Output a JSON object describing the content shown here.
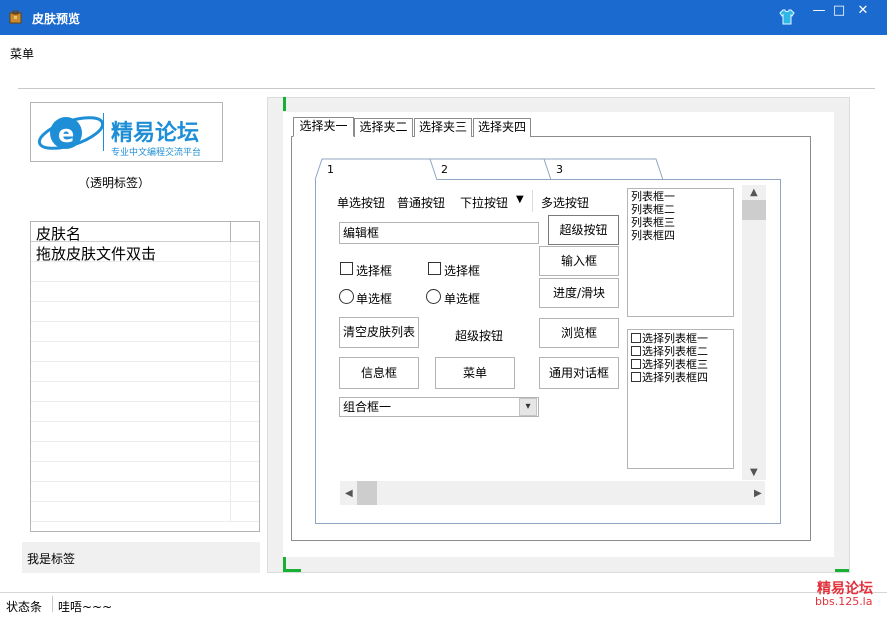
{
  "window": {
    "title": "皮肤预览",
    "controls": {
      "minimize": "—",
      "maximize": "□",
      "close": "✕"
    },
    "colors": {
      "titlebar": "#1b6ad0"
    }
  },
  "menu": {
    "label": "菜单"
  },
  "left_panel": {
    "logo": {
      "name": "精易论坛",
      "tagline": "专业中文编程交流平台"
    },
    "transparent_label": "（透明标签）",
    "skin_list": {
      "columns": [
        "皮肤名"
      ],
      "rows": [
        "拖放皮肤文件双击"
      ]
    },
    "tag_label": "我是标签"
  },
  "preview": {
    "outer_tabs": [
      "选择夹一",
      "选择夹二",
      "选择夹三",
      "选择夹四"
    ],
    "inner_tabs": [
      "1",
      "2",
      "3"
    ],
    "toolbar": {
      "radio_button": "单选按钮",
      "normal_button": "普通按钮",
      "dropdown_button": "下拉按钮",
      "multi_select_button": "多选按钮"
    },
    "edit_box": "编辑框",
    "buttons": {
      "super_button": "超级按钮",
      "input_box": "输入框",
      "progress_slider": "进度/滑块",
      "browse_box": "浏览框",
      "clear_skin_list": "清空皮肤列表",
      "super_button_label": "超级按钮",
      "info_box": "信息框",
      "menu": "菜单",
      "common_dialog": "通用对话框"
    },
    "checkboxes": [
      "选择框",
      "选择框"
    ],
    "radios": [
      "单选框",
      "单选框"
    ],
    "combo": "组合框一",
    "listbox": [
      "列表框一",
      "列表框二",
      "列表框三",
      "列表框四"
    ],
    "checklist": [
      "选择列表框一",
      "选择列表框二",
      "选择列表框三",
      "选择列表框四"
    ]
  },
  "status": {
    "label": "状态条",
    "text": "哇唔~~~"
  },
  "watermark": {
    "name": "精易论坛",
    "url": "bbs.125.la"
  }
}
